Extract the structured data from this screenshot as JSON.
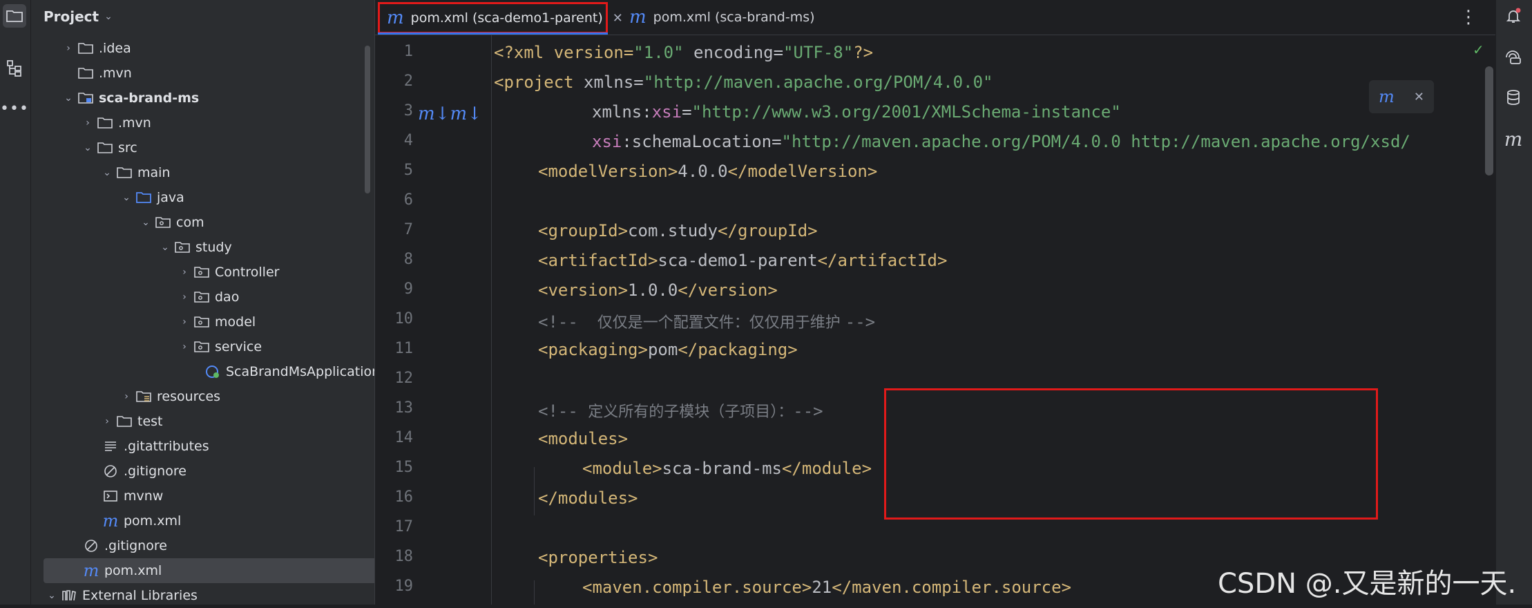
{
  "project_panel": {
    "title": "Project",
    "tree": [
      {
        "label": "​.idea",
        "display": ".idea"
      },
      {
        "display": ".mvn"
      },
      {
        "display": "sca-brand-ms"
      },
      {
        "display": ".mvn"
      },
      {
        "display": "src"
      },
      {
        "display": "main"
      },
      {
        "display": "java"
      },
      {
        "display": "com"
      },
      {
        "display": "study"
      },
      {
        "display": "Controller"
      },
      {
        "display": "dao"
      },
      {
        "display": "model"
      },
      {
        "display": "service"
      },
      {
        "display": "ScaBrandMsApplication"
      },
      {
        "display": "resources"
      },
      {
        "display": "test"
      },
      {
        "display": ".gitattributes"
      },
      {
        "display": ".gitignore"
      },
      {
        "display": "mvnw"
      },
      {
        "display": "pom.xml"
      },
      {
        "display": ".gitignore"
      },
      {
        "display": "pom.xml"
      },
      {
        "display": "External Libraries"
      }
    ]
  },
  "tabs": [
    {
      "label": "pom.xml (sca-demo1-parent)",
      "icon": "maven-icon",
      "active": true
    },
    {
      "label": "pom.xml (sca-brand-ms)",
      "icon": "maven-icon",
      "active": false
    }
  ],
  "editor": {
    "line_numbers": [
      "1",
      "2",
      "3",
      "4",
      "5",
      "6",
      "7",
      "8",
      "9",
      "10",
      "11",
      "12",
      "13",
      "14",
      "15",
      "16",
      "17",
      "18",
      "19"
    ],
    "lines": {
      "l1": {
        "a": "<?xml version=",
        "b": "\"1.0\"",
        "c": " encoding=",
        "d": "\"UTF-8\"",
        "e": "?>"
      },
      "l2": {
        "a": "<project",
        "b": " xmlns=",
        "c": "\"http://maven.apache.org/POM/4.0.0\""
      },
      "l3": {
        "a": "xmlns:",
        "b": "xsi",
        "c": "=",
        "d": "\"http://www.w3.org/2001/XMLSchema-instance\""
      },
      "l4": {
        "a": "xsi",
        "b": ":schemaLocation=",
        "c": "\"http://maven.apache.org/POM/4.0.0 http://maven.apache.org/xsd/"
      },
      "l5": {
        "a": "<modelVersion>",
        "b": "4.0.0",
        "c": "</modelVersion>"
      },
      "l7": {
        "a": "<groupId>",
        "b": "com.study",
        "c": "</groupId>"
      },
      "l8": {
        "a": "<artifactId>",
        "b": "sca-demo1-parent",
        "c": "</artifactId>"
      },
      "l9": {
        "a": "<version>",
        "b": "1.0.0",
        "c": "</version>"
      },
      "l10": {
        "a": "<!--",
        "b": "    仅仅是一个配置文件：仅仅用于维护 ",
        "c": "-->"
      },
      "l11": {
        "a": "<packaging>",
        "b": "pom",
        "c": "</packaging>"
      },
      "l13": {
        "a": "<!-- ",
        "b": "定义所有的子模块（子项目）：",
        "c": "-->"
      },
      "l14": {
        "a": "<modules>"
      },
      "l15": {
        "a": "<module>",
        "b": "sca-brand-ms",
        "c": "</module>"
      },
      "l16": {
        "a": "</modules>"
      },
      "l18": {
        "a": "<properties>"
      },
      "l19": {
        "a": "<maven.compiler.source>",
        "b": "21",
        "c": "</maven.compiler.source>"
      }
    }
  },
  "watermark": "CSDN @.又是新的一天."
}
